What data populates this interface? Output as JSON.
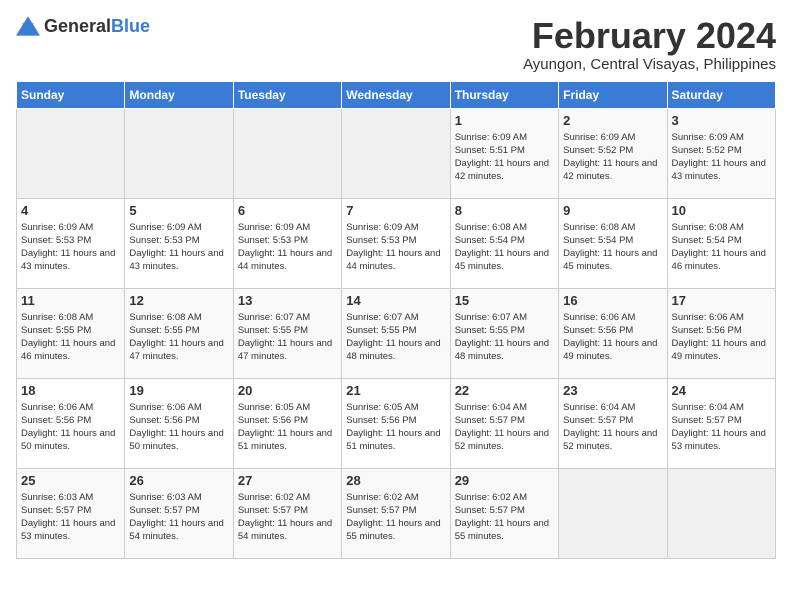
{
  "header": {
    "logo_general": "General",
    "logo_blue": "Blue",
    "title": "February 2024",
    "subtitle": "Ayungon, Central Visayas, Philippines"
  },
  "columns": [
    "Sunday",
    "Monday",
    "Tuesday",
    "Wednesday",
    "Thursday",
    "Friday",
    "Saturday"
  ],
  "weeks": [
    {
      "days": [
        {
          "num": "",
          "empty": true
        },
        {
          "num": "",
          "empty": true
        },
        {
          "num": "",
          "empty": true
        },
        {
          "num": "",
          "empty": true
        },
        {
          "num": "1",
          "sunrise": "6:09 AM",
          "sunset": "5:51 PM",
          "daylight": "11 hours and 42 minutes."
        },
        {
          "num": "2",
          "sunrise": "6:09 AM",
          "sunset": "5:52 PM",
          "daylight": "11 hours and 42 minutes."
        },
        {
          "num": "3",
          "sunrise": "6:09 AM",
          "sunset": "5:52 PM",
          "daylight": "11 hours and 43 minutes."
        }
      ]
    },
    {
      "days": [
        {
          "num": "4",
          "sunrise": "6:09 AM",
          "sunset": "5:53 PM",
          "daylight": "11 hours and 43 minutes."
        },
        {
          "num": "5",
          "sunrise": "6:09 AM",
          "sunset": "5:53 PM",
          "daylight": "11 hours and 43 minutes."
        },
        {
          "num": "6",
          "sunrise": "6:09 AM",
          "sunset": "5:53 PM",
          "daylight": "11 hours and 44 minutes."
        },
        {
          "num": "7",
          "sunrise": "6:09 AM",
          "sunset": "5:53 PM",
          "daylight": "11 hours and 44 minutes."
        },
        {
          "num": "8",
          "sunrise": "6:08 AM",
          "sunset": "5:54 PM",
          "daylight": "11 hours and 45 minutes."
        },
        {
          "num": "9",
          "sunrise": "6:08 AM",
          "sunset": "5:54 PM",
          "daylight": "11 hours and 45 minutes."
        },
        {
          "num": "10",
          "sunrise": "6:08 AM",
          "sunset": "5:54 PM",
          "daylight": "11 hours and 46 minutes."
        }
      ]
    },
    {
      "days": [
        {
          "num": "11",
          "sunrise": "6:08 AM",
          "sunset": "5:55 PM",
          "daylight": "11 hours and 46 minutes."
        },
        {
          "num": "12",
          "sunrise": "6:08 AM",
          "sunset": "5:55 PM",
          "daylight": "11 hours and 47 minutes."
        },
        {
          "num": "13",
          "sunrise": "6:07 AM",
          "sunset": "5:55 PM",
          "daylight": "11 hours and 47 minutes."
        },
        {
          "num": "14",
          "sunrise": "6:07 AM",
          "sunset": "5:55 PM",
          "daylight": "11 hours and 48 minutes."
        },
        {
          "num": "15",
          "sunrise": "6:07 AM",
          "sunset": "5:55 PM",
          "daylight": "11 hours and 48 minutes."
        },
        {
          "num": "16",
          "sunrise": "6:06 AM",
          "sunset": "5:56 PM",
          "daylight": "11 hours and 49 minutes."
        },
        {
          "num": "17",
          "sunrise": "6:06 AM",
          "sunset": "5:56 PM",
          "daylight": "11 hours and 49 minutes."
        }
      ]
    },
    {
      "days": [
        {
          "num": "18",
          "sunrise": "6:06 AM",
          "sunset": "5:56 PM",
          "daylight": "11 hours and 50 minutes."
        },
        {
          "num": "19",
          "sunrise": "6:06 AM",
          "sunset": "5:56 PM",
          "daylight": "11 hours and 50 minutes."
        },
        {
          "num": "20",
          "sunrise": "6:05 AM",
          "sunset": "5:56 PM",
          "daylight": "11 hours and 51 minutes."
        },
        {
          "num": "21",
          "sunrise": "6:05 AM",
          "sunset": "5:56 PM",
          "daylight": "11 hours and 51 minutes."
        },
        {
          "num": "22",
          "sunrise": "6:04 AM",
          "sunset": "5:57 PM",
          "daylight": "11 hours and 52 minutes."
        },
        {
          "num": "23",
          "sunrise": "6:04 AM",
          "sunset": "5:57 PM",
          "daylight": "11 hours and 52 minutes."
        },
        {
          "num": "24",
          "sunrise": "6:04 AM",
          "sunset": "5:57 PM",
          "daylight": "11 hours and 53 minutes."
        }
      ]
    },
    {
      "days": [
        {
          "num": "25",
          "sunrise": "6:03 AM",
          "sunset": "5:57 PM",
          "daylight": "11 hours and 53 minutes."
        },
        {
          "num": "26",
          "sunrise": "6:03 AM",
          "sunset": "5:57 PM",
          "daylight": "11 hours and 54 minutes."
        },
        {
          "num": "27",
          "sunrise": "6:02 AM",
          "sunset": "5:57 PM",
          "daylight": "11 hours and 54 minutes."
        },
        {
          "num": "28",
          "sunrise": "6:02 AM",
          "sunset": "5:57 PM",
          "daylight": "11 hours and 55 minutes."
        },
        {
          "num": "29",
          "sunrise": "6:02 AM",
          "sunset": "5:57 PM",
          "daylight": "11 hours and 55 minutes."
        },
        {
          "num": "",
          "empty": true
        },
        {
          "num": "",
          "empty": true
        }
      ]
    }
  ],
  "labels": {
    "sunrise_prefix": "Sunrise: ",
    "sunset_prefix": "Sunset: ",
    "daylight_prefix": "Daylight: "
  }
}
